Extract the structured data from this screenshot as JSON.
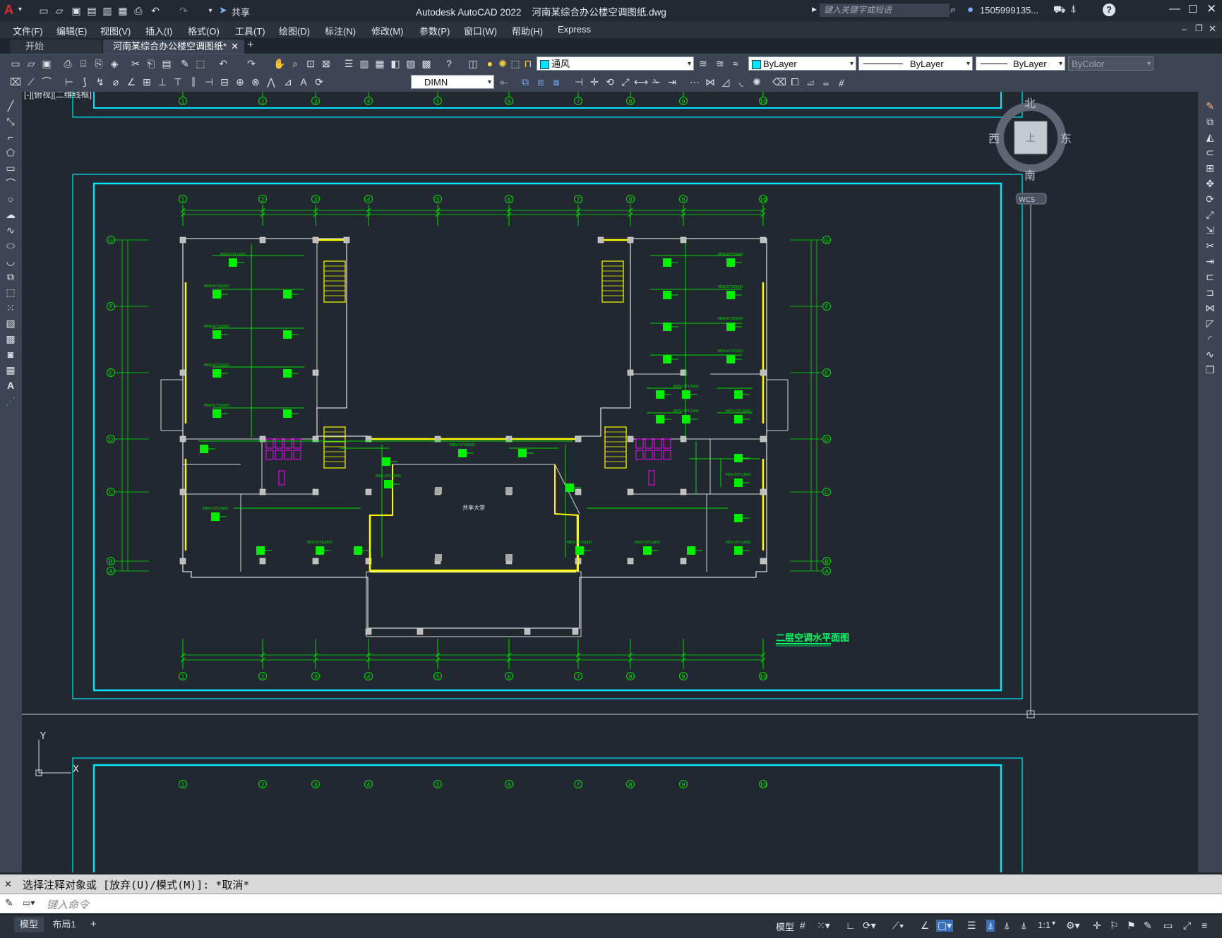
{
  "app": {
    "title": "Autodesk AutoCAD 2022    河南某综合办公楼空调图纸.dwg",
    "share_label": "共享",
    "search_placeholder": "键入关键字或短语",
    "user": "1505999135...",
    "help": "?"
  },
  "menu": [
    "文件(F)",
    "编辑(E)",
    "视图(V)",
    "插入(I)",
    "格式(O)",
    "工具(T)",
    "绘图(D)",
    "标注(N)",
    "修改(M)",
    "参数(P)",
    "窗口(W)",
    "帮助(H)",
    "Express"
  ],
  "tabs": {
    "start": "开始",
    "active": "河南某综合办公楼空调图纸*",
    "add": "+"
  },
  "toolbar": {
    "layer_value": "通风",
    "color_value": "ByLayer",
    "linetype_value": "ByLayer",
    "lineweight_value": "ByLayer",
    "plotstyle_value": "ByColor",
    "dimstyle_value": "DIMN"
  },
  "viewport": {
    "label": "[-][俯视][二维线框]"
  },
  "viewcube": {
    "north": "北",
    "south": "南",
    "east": "东",
    "west": "西",
    "top": "上",
    "wcs": "WCS"
  },
  "ucs": {
    "x": "X",
    "y": "Y"
  },
  "drawing": {
    "title": "二层空调水平面图",
    "center_label": "共享大堂",
    "column_labels": [
      "1",
      "2",
      "3",
      "4",
      "5",
      "6",
      "7",
      "8",
      "9",
      "10"
    ],
    "row_labels": [
      "G",
      "F",
      "E",
      "D",
      "C",
      "B",
      "A"
    ],
    "equipment_tag": "MDV-D71Q4/D"
  },
  "command": {
    "history": "选择注释对象或 [放弃(U)/模式(M)]: *取消*",
    "input_placeholder": "键入命令"
  },
  "status": {
    "model_tab": "模型",
    "layout_tab": "布局1",
    "add_tab": "+",
    "model_btn": "模型",
    "scale": "1:1"
  },
  "colors": {
    "background": "#212830",
    "frame": "#00e5ff",
    "grid": "#00dd00",
    "wall": "#ffff00",
    "equipment": "#00ee00",
    "restroom": "#ff00ff"
  }
}
